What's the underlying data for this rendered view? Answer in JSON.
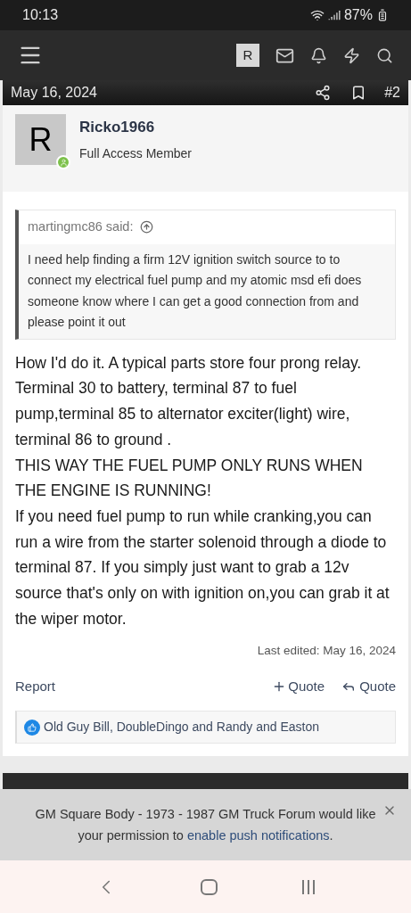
{
  "status_bar": {
    "time": "10:13",
    "battery": "87%"
  },
  "nav": {
    "avatar_letter": "R"
  },
  "post": {
    "date": "May 16, 2024",
    "number": "#2",
    "author": {
      "avatar_letter": "R",
      "name": "Ricko1966",
      "title": "Full Access Member",
      "online": true
    },
    "quote": {
      "attribution": "martingmc86 said:",
      "text": "I need help finding a firm 12V ignition switch source to to connect my electrical fuel pump and my atomic msd efi does someone know where I can get a good connection from and please point it out"
    },
    "body": [
      "How I'd do it. A typical parts store four prong relay. Terminal 30 to battery, terminal 87 to fuel pump,terminal 85 to alternator exciter(light) wire, terminal 86 to ground .",
      "THIS WAY THE FUEL PUMP ONLY RUNS WHEN THE ENGINE IS RUNNING!",
      "If you need fuel pump to run while cranking,you can run a wire from the starter solenoid through a diode to terminal 87. If you simply just want to grab a 12v source that's only on with ignition on,you can grab it at the wiper motor."
    ],
    "last_edited": "Last edited: May 16, 2024",
    "actions": {
      "report": "Report",
      "multi_quote": "Quote",
      "reply_quote": "Quote"
    },
    "reactions": "Old Guy Bill, DoubleDingo and Randy and Easton"
  },
  "banner": {
    "text": "GM Square Body - 1973 - 1987 GM Truck Forum would like your permission to",
    "link": "enable push notifications",
    "end": "."
  }
}
